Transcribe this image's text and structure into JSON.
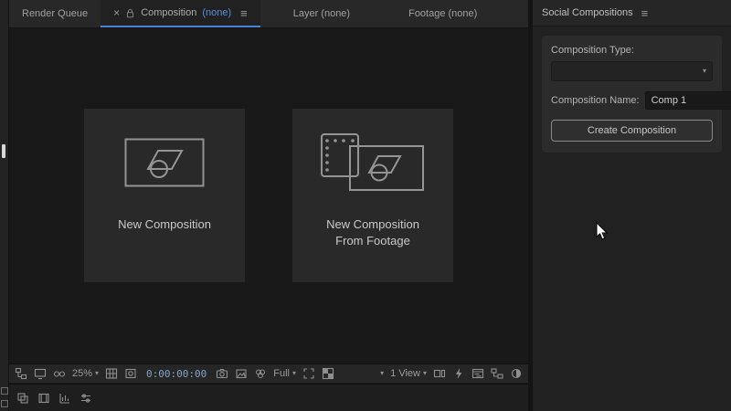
{
  "icons": {
    "close": "×",
    "menu": "≡",
    "chevron": "▾"
  },
  "tabbar": {
    "render_queue": "Render Queue",
    "composition": {
      "label": "Composition",
      "none": "(none)"
    },
    "layer": "Layer (none)",
    "footage": "Footage (none)"
  },
  "viewer": {
    "new_composition": "New Composition",
    "new_composition_from_footage": "New Composition\nFrom Footage"
  },
  "statusbar": {
    "zoom": "25%",
    "timecode": "0:00:00:00",
    "resolution": "Full",
    "view_layout": "1 View"
  },
  "social_panel": {
    "title": "Social Compositions",
    "type_label": "Composition Type:",
    "type_value": "",
    "name_label": "Composition Name:",
    "name_value": "Comp 1",
    "create_label": "Create Composition"
  },
  "colors": {
    "accent": "#4a82d8",
    "tab_none_blue": "#5b8fdc",
    "timecode_blue": "#84a4c4"
  }
}
